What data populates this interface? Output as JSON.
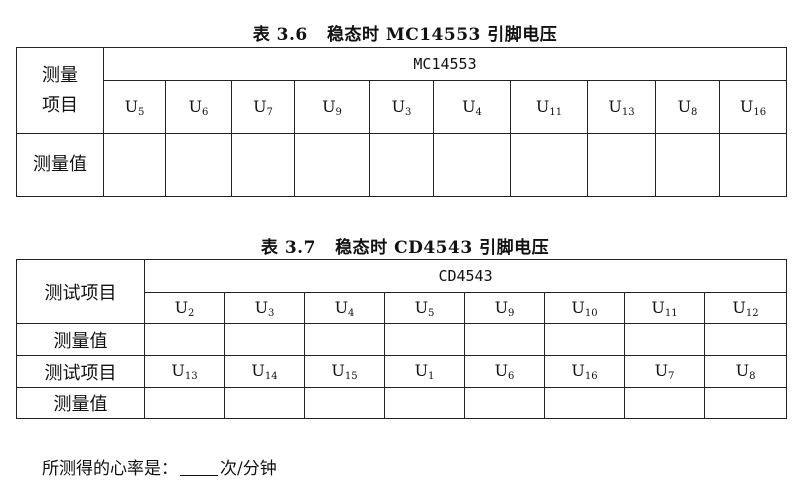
{
  "table1": {
    "caption": "表 3.6   稳态时 MC14553 引脚电压",
    "row_label_line1": "测量",
    "row_label_line2": "项目",
    "chip": "MC14553",
    "pins": [
      "5",
      "6",
      "7",
      "9",
      "3",
      "4",
      "11",
      "13",
      "8",
      "16"
    ],
    "pin_letter": "U",
    "value_label": "测量值"
  },
  "table2": {
    "caption": "表 3.7   稳态时 CD4543 引脚电压",
    "row_label": "测试项目",
    "chip": "CD4543",
    "pins_row1": [
      "2",
      "3",
      "4",
      "5",
      "9",
      "10",
      "11",
      "12"
    ],
    "pins_row2": [
      "13",
      "14",
      "15",
      "1",
      "6",
      "16",
      "7",
      "8"
    ],
    "pin_letter": "U",
    "value_label": "测量值"
  },
  "footer": {
    "prefix": "所测得的心率是：",
    "suffix": "次/分钟"
  }
}
